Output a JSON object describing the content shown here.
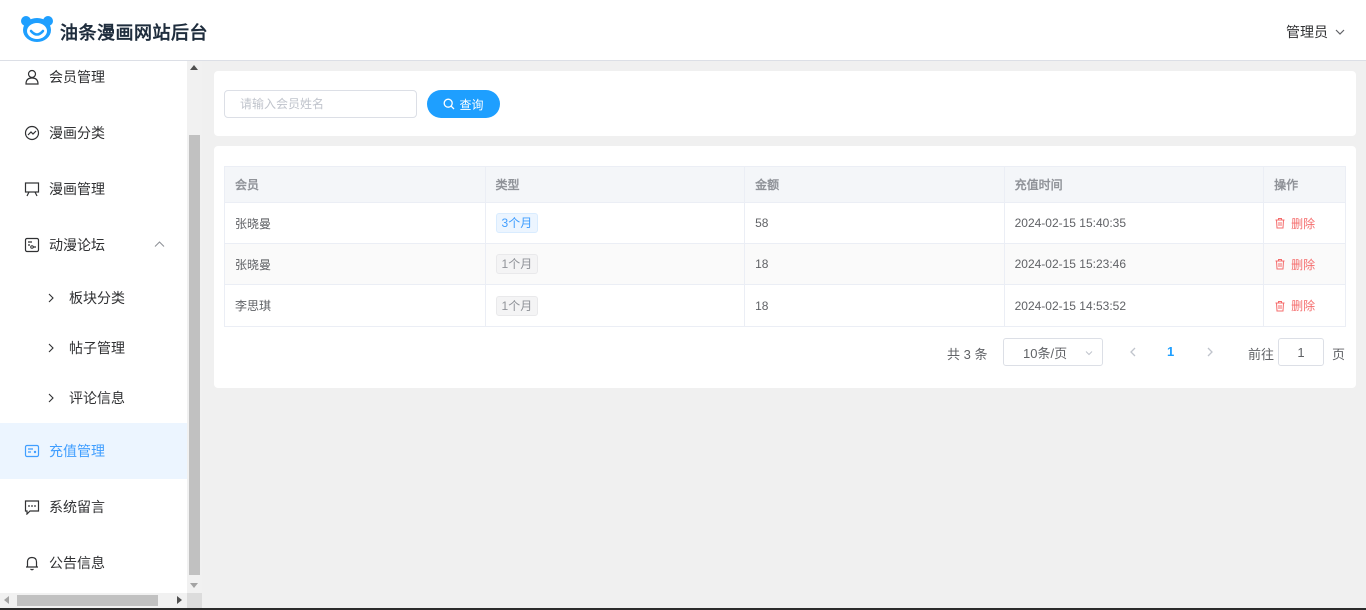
{
  "header": {
    "brand": "油条漫画网站后台",
    "user_label": "管理员",
    "logo_icon": "bear-logo-icon",
    "accent": "#1e9fff"
  },
  "sidebar": {
    "items": [
      {
        "label": "会员管理",
        "icon": "user-icon"
      },
      {
        "label": "漫画分类",
        "icon": "chart-icon"
      },
      {
        "label": "漫画管理",
        "icon": "easel-icon"
      },
      {
        "label": "动漫论坛",
        "icon": "forum-icon",
        "expanded": true
      },
      {
        "label": "充值管理",
        "icon": "recharge-icon",
        "active": true
      },
      {
        "label": "系统留言",
        "icon": "message-icon"
      },
      {
        "label": "公告信息",
        "icon": "bell-icon"
      }
    ],
    "sub_items": [
      {
        "label": "板块分类"
      },
      {
        "label": "帖子管理"
      },
      {
        "label": "评论信息"
      }
    ],
    "active_color": "#409eff"
  },
  "search": {
    "placeholder": "请输入会员姓名",
    "value": "",
    "button_label": "查询"
  },
  "table": {
    "columns": [
      "会员",
      "类型",
      "金额",
      "充值时间",
      "操作"
    ],
    "rows": [
      {
        "member": "张晓曼",
        "type": "3个月",
        "type_style": "blue",
        "amount": "58",
        "time": "2024-02-15 15:40:35",
        "action": "删除"
      },
      {
        "member": "张晓曼",
        "type": "1个月",
        "type_style": "gray",
        "amount": "18",
        "time": "2024-02-15 15:23:46",
        "action": "删除"
      },
      {
        "member": "李思琪",
        "type": "1个月",
        "type_style": "gray",
        "amount": "18",
        "time": "2024-02-15 14:53:52",
        "action": "删除"
      }
    ]
  },
  "pagination": {
    "total": "共 3 条",
    "page_size": "10条/页",
    "current_page": "1",
    "jump_label": "前往",
    "jump_value": "1",
    "jump_suffix": "页"
  }
}
